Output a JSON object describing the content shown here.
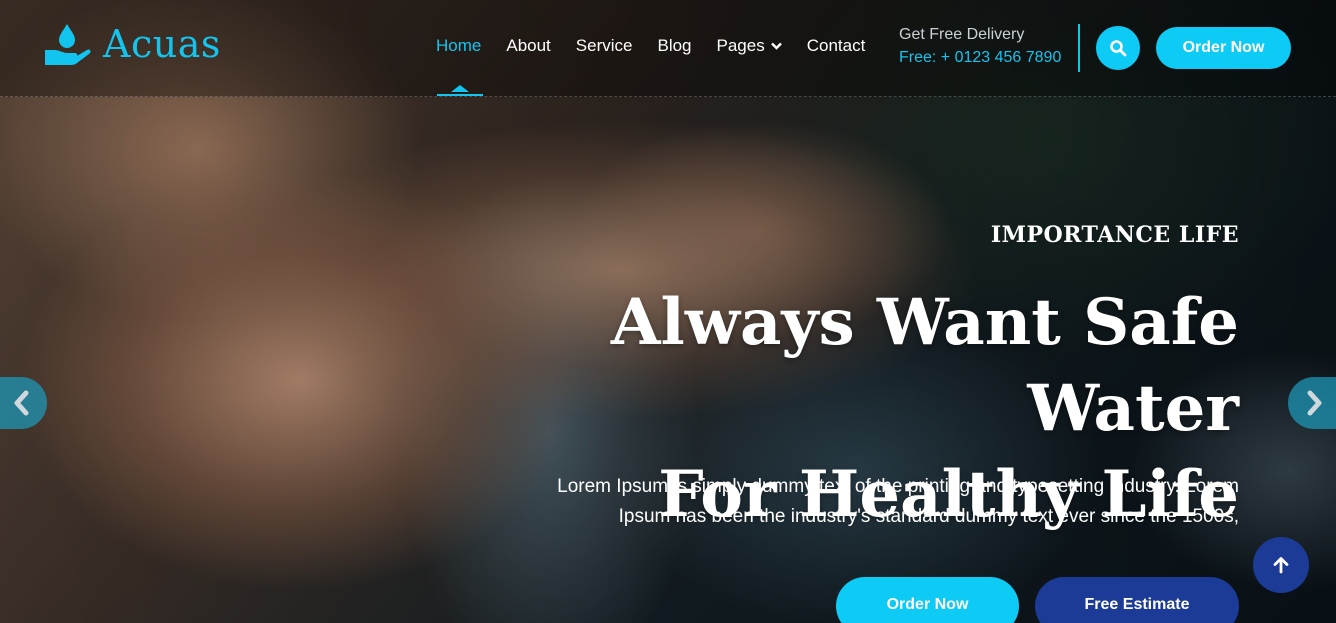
{
  "brand": {
    "name": "Acuas",
    "icon": "water-drop-hand-icon",
    "accent": "#13c4ee"
  },
  "nav": {
    "items": [
      {
        "label": "Home",
        "active": true
      },
      {
        "label": "About"
      },
      {
        "label": "Service"
      },
      {
        "label": "Blog"
      },
      {
        "label": "Pages",
        "has_dropdown": true
      },
      {
        "label": "Contact"
      }
    ]
  },
  "delivery": {
    "title": "Get Free Delivery",
    "phone": "Free: + 0123 456 7890"
  },
  "header": {
    "search_icon": "search-icon",
    "order_button": "Order Now"
  },
  "hero": {
    "subtitle": "IMPORTANCE LIFE",
    "title_line1": "Always Want Safe Water",
    "title_line2": "For Healthy Life",
    "description_line1": "Lorem Ipsum is simply dummy text of the printing and typesetting industry. Lorem",
    "description_line2": "Ipsum has been the industry's standard dummy text ever since the 1500s,",
    "primary_button": "Order Now",
    "secondary_button": "Free Estimate"
  },
  "colors": {
    "primary": "#0ecbf5",
    "secondary": "#1c3b96"
  },
  "controls": {
    "prev_icon": "chevron-left-icon",
    "next_icon": "chevron-right-icon",
    "back_to_top_icon": "arrow-up-icon"
  }
}
